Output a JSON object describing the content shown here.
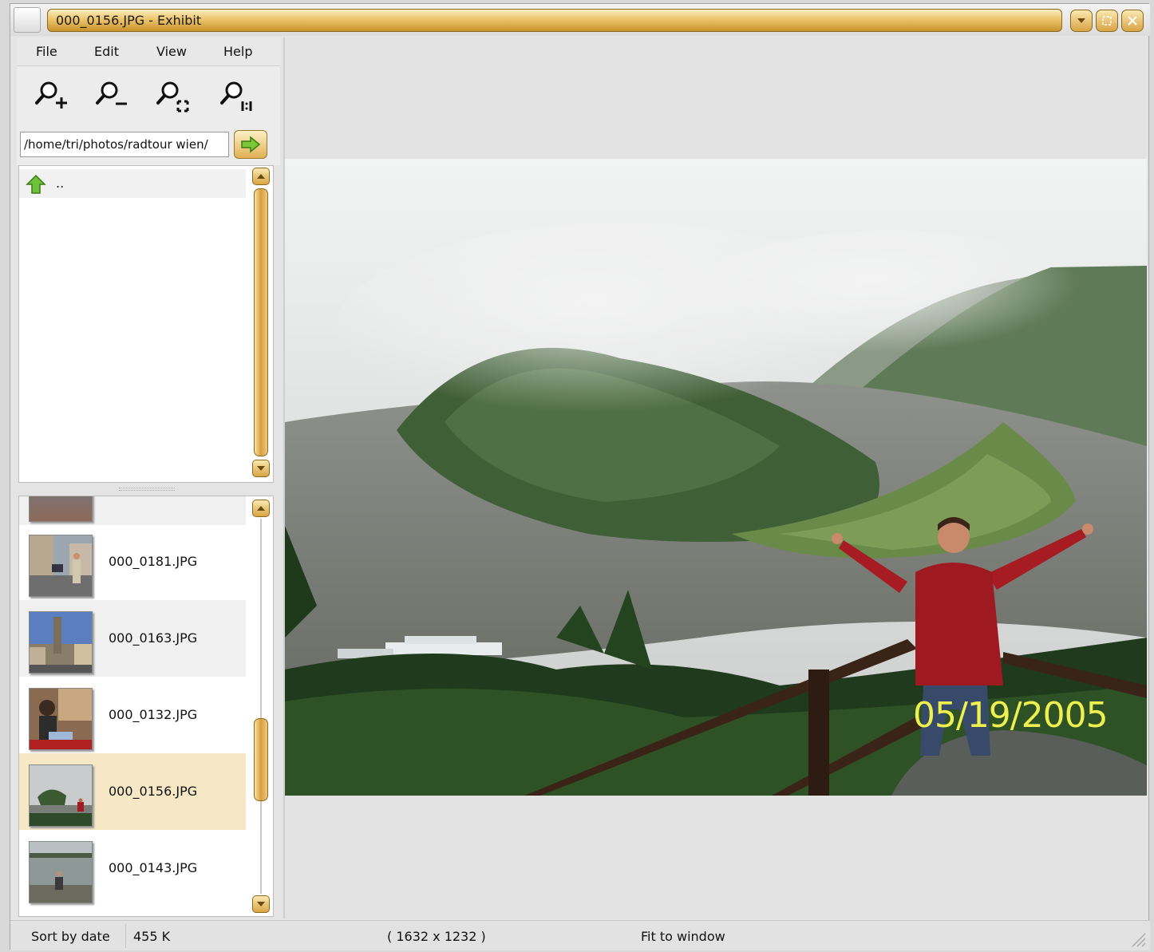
{
  "window": {
    "title": "000_0156.JPG - Exhibit"
  },
  "menu": {
    "file": "File",
    "edit": "Edit",
    "view": "View",
    "help": "Help"
  },
  "toolbar": {
    "zoom_in": "zoom-in-icon",
    "zoom_out": "zoom-out-icon",
    "zoom_fit": "zoom-fit-icon",
    "zoom_1_1": "zoom-actual-size-icon"
  },
  "path": {
    "value": "/home/tri/photos/radtour wien/"
  },
  "directories": [
    {
      "label": ".."
    }
  ],
  "thumbnails": [
    {
      "name": "000_0181.JPG"
    },
    {
      "name": "000_0163.JPG"
    },
    {
      "name": "000_0132.JPG"
    },
    {
      "name": "000_0156.JPG"
    },
    {
      "name": "000_0143.JPG"
    }
  ],
  "image": {
    "date_stamp": "05/19/2005"
  },
  "status": {
    "sort": "Sort by date",
    "size": "455 K",
    "dimensions": "( 1632 x 1232 )",
    "zoom_mode": "Fit to window"
  },
  "colors": {
    "accent": "#d9a445",
    "selected_row": "#f6e8c4"
  }
}
